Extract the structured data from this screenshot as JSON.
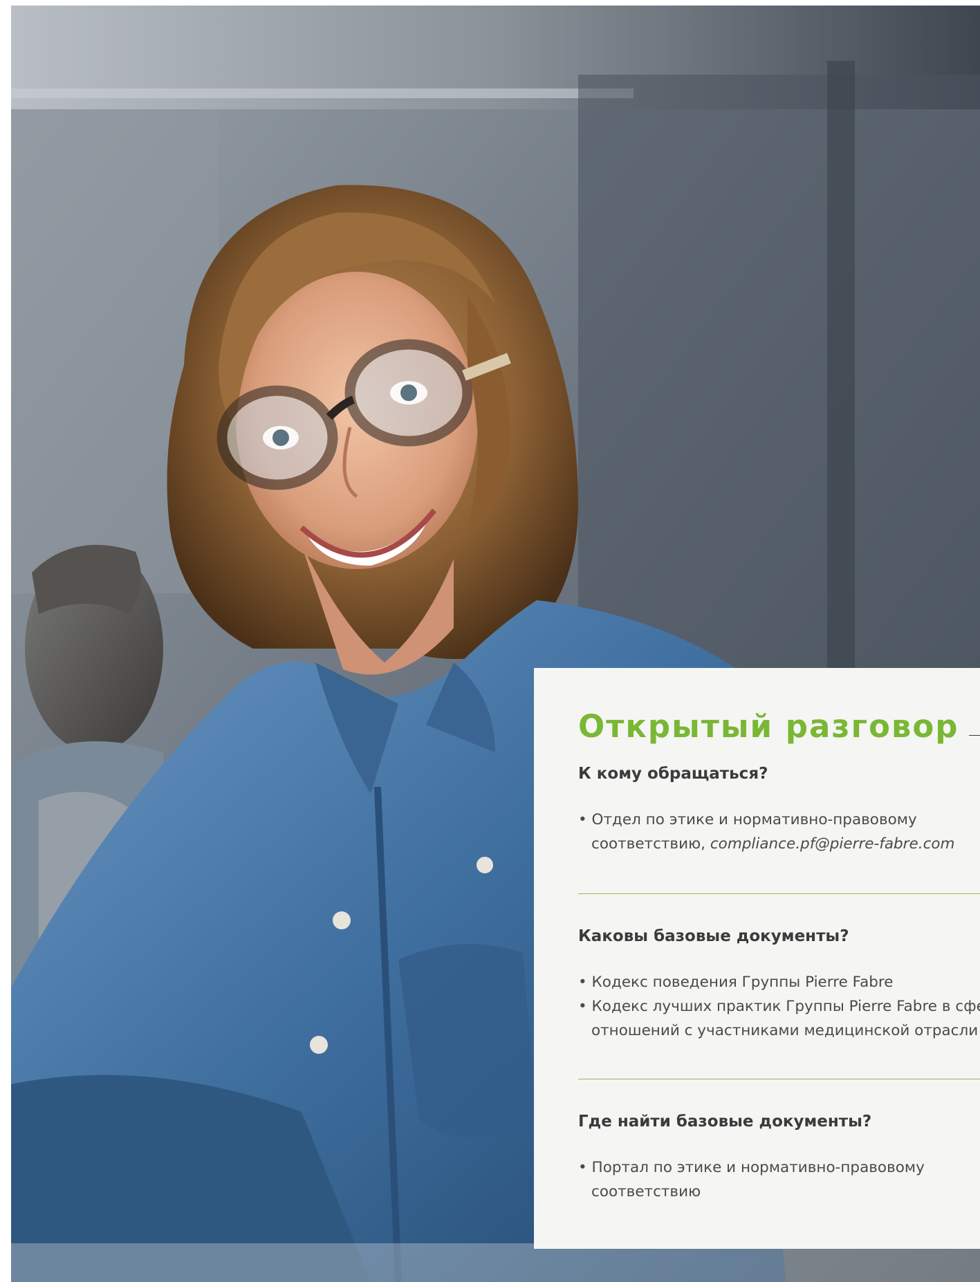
{
  "photo": {
    "description_icon": "photo-woman-smiling-glasses-denim-shirt"
  },
  "colors": {
    "accent_green": "#7ab734",
    "divider_green": "#8cbf47",
    "card_background": "#f5f5f3",
    "heading_dark": "#3b3b3b",
    "body_text": "#4a4a4a"
  },
  "card": {
    "title": "Открытый разговор",
    "sections": [
      {
        "heading": "К кому обращаться?",
        "items": [
          {
            "text": "Отдел по этике и нормативно-правовому",
            "continuation_prefix": "соответствию, ",
            "email": "compliance.pf@pierre-fabre.com"
          }
        ]
      },
      {
        "heading": "Каковы базовые документы?",
        "items": [
          {
            "text": "Кодекс поведения Группы Pierre Fabre"
          },
          {
            "text": "Кодекс лучших практик Группы Pierre Fabre в сфере",
            "continuation": "отношений с участниками медицинской отрасли"
          }
        ]
      },
      {
        "heading": "Где найти базовые документы?",
        "items": [
          {
            "text": "Портал по этике и нормативно-правовому",
            "continuation": "соответствию"
          }
        ]
      }
    ],
    "bullet": "•"
  }
}
